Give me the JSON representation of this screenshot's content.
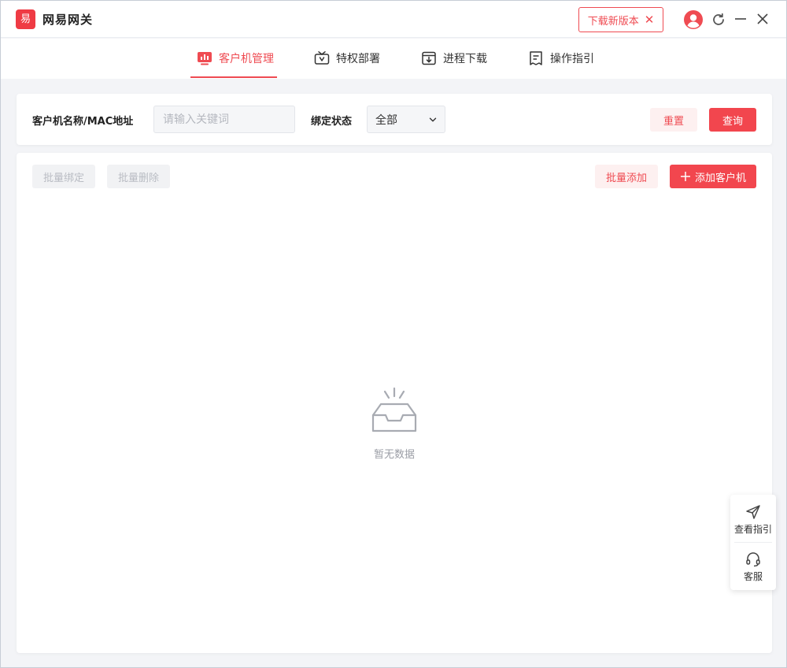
{
  "app": {
    "logo_char": "易",
    "title": "网易网关"
  },
  "titlebar": {
    "update_label": "下载新版本",
    "update_close": "✕"
  },
  "nav": {
    "tabs": [
      {
        "label": "客户机管理",
        "icon": "monitor-chart-icon",
        "active": true
      },
      {
        "label": "特权部署",
        "icon": "tv-privilege-icon",
        "active": false
      },
      {
        "label": "进程下载",
        "icon": "download-box-icon",
        "active": false
      },
      {
        "label": "操作指引",
        "icon": "document-guide-icon",
        "active": false
      }
    ]
  },
  "filter": {
    "name_label": "客户机名称/MAC地址",
    "keyword_placeholder": "请输入关键词",
    "keyword_value": "",
    "bind_status_label": "绑定状态",
    "bind_status_value": "全部",
    "reset_label": "重置",
    "query_label": "查询"
  },
  "toolbar": {
    "batch_bind_label": "批量绑定",
    "batch_delete_label": "批量删除",
    "batch_add_label": "批量添加",
    "add_client_label": "添加客户机",
    "add_client_prefix": "+"
  },
  "empty": {
    "text": "暂无数据"
  },
  "float_panel": {
    "guide_label": "查看指引",
    "service_label": "客服"
  },
  "colors": {
    "accent": "#ef4b52",
    "accent_light": "#fdf0f0",
    "disabled_bg": "#f1f2f4",
    "disabled_text": "#b9bcc3"
  }
}
